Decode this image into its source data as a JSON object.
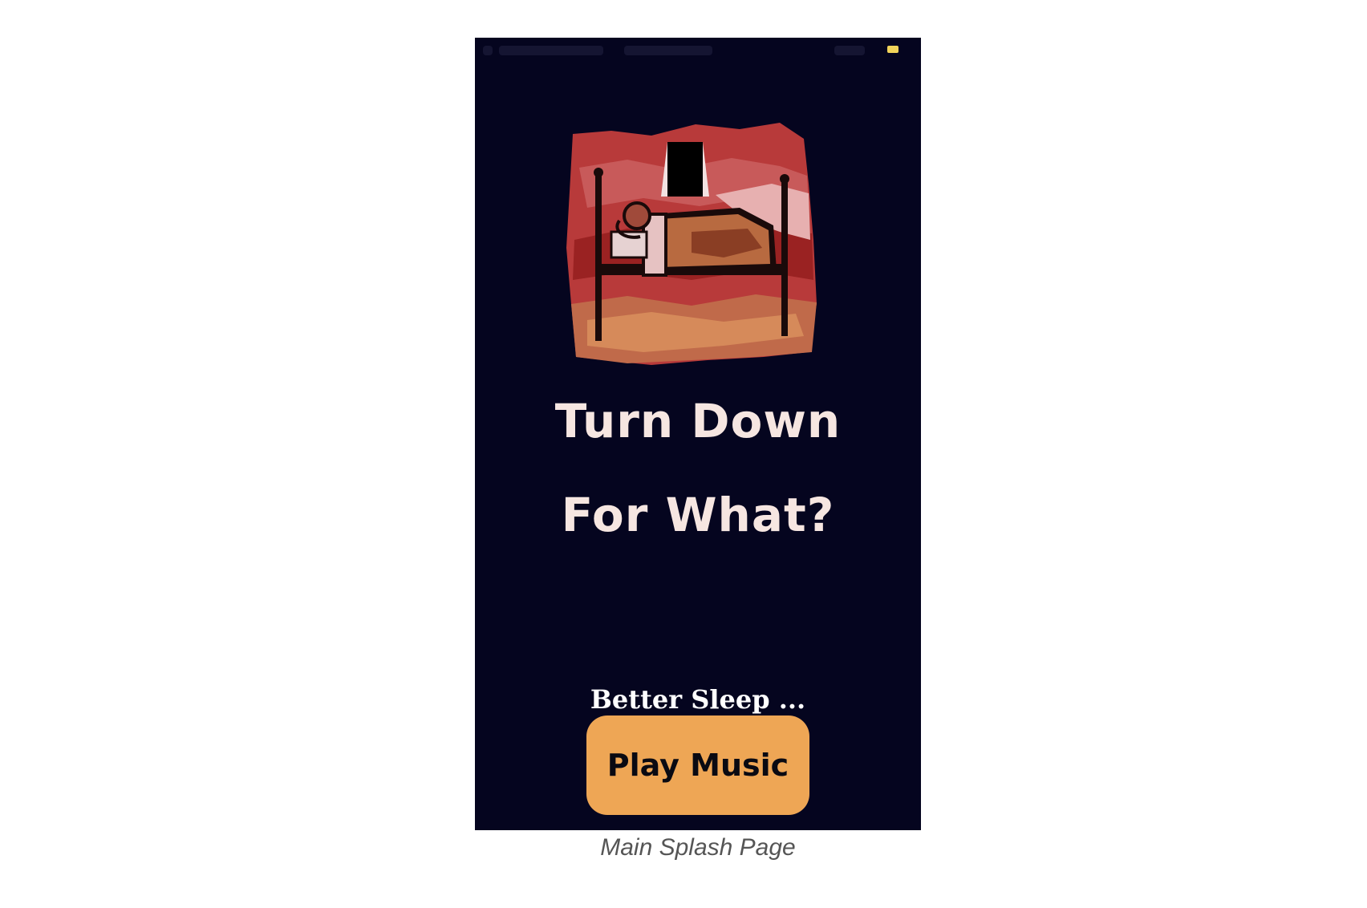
{
  "app": {
    "title_line1": "Turn Down",
    "title_line2": "For What?",
    "tagline": "Better Sleep ...",
    "play_button_label": "Play Music"
  },
  "hero": {
    "icon": "sleeping-person-bed-illustration"
  },
  "caption": "Main Splash Page",
  "colors": {
    "background": "#05051f",
    "title_text": "#f6e6e1",
    "button": "#eea655",
    "button_text": "#0a0a12",
    "battery": "#f2d45a"
  }
}
